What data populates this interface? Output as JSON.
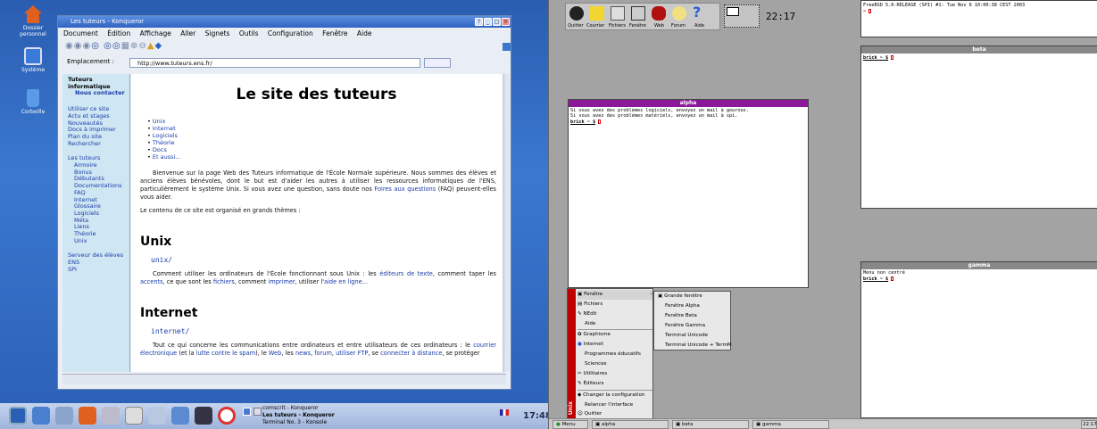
{
  "kde": {
    "desktop_icons": [
      {
        "label": "Dossier personnel",
        "color": "#e06020"
      },
      {
        "label": "Système",
        "color": "#3a7ad8"
      },
      {
        "label": "Corbeille",
        "color": "#5a9ae8"
      }
    ],
    "window_title": "Les tuteurs - Konqueror",
    "title_buttons": [
      "?",
      "_",
      "□",
      "×"
    ],
    "menu": [
      "Document",
      "Édition",
      "Affichage",
      "Aller",
      "Signets",
      "Outils",
      "Configuration",
      "Fenêtre",
      "Aide"
    ],
    "location_label": "Emplacement :",
    "url": "http://www.tuteurs.ens.fr/",
    "sidebar_top": [
      "Tuteurs informatique",
      "Nous contacter"
    ],
    "sidebar_links1": [
      "Utiliser ce site",
      "Actu et stages",
      "Nouveautés",
      "Docs à imprimer",
      "Plan du site",
      "Rechercher"
    ],
    "sidebar_head2": "Les tuteurs",
    "sidebar_links2": [
      "Armoire",
      "Bonus",
      "Débutants",
      "Documentations",
      "FAQ",
      "Internet",
      "Glossaire",
      "Logiciels",
      "Méta",
      "Liens",
      "Théorie",
      "Unix"
    ],
    "sidebar_links3": [
      "Serveur des élèves",
      "ENS",
      "SPI"
    ],
    "page_title": "Le site des tuteurs",
    "bullets": [
      "Unix",
      "Internet",
      "Logiciels",
      "Théorie",
      "Docs",
      "Et aussi..."
    ],
    "intro_p": "Bienvenue sur la page Web des Tuteurs informatique de l'École Normale supérieure. Nous sommes des élèves et anciens élèves bénévoles, dont le but est d'aider les autres à utiliser les ressources informatiques de l'ENS, particulièrement le système Unix. Si vous avez une question, sans doute nos",
    "intro_link": "Foires aux questions",
    "intro_end": "(FAQ) peuvent-elles vous aider.",
    "themes_p": "Le contenu de ce site est organisé en grands thèmes :",
    "unix_h": "Unix",
    "unix_code": "unix/",
    "unix_p1": "Comment utiliser les ordinateurs de l'École fonctionnant sous Unix : les",
    "unix_l1": "éditeurs de texte",
    "unix_p2": ", comment taper les",
    "unix_l2": "accents",
    "unix_p3": ", ce que sont les",
    "unix_l3": "fichiers",
    "unix_p4": ", comment",
    "unix_l4": "imprimer",
    "unix_p5": ", utiliser l'",
    "unix_l5": "aide en ligne...",
    "inet_h": "Internet",
    "inet_code": "internet/",
    "inet_p1": "Tout ce qui concerne les communications entre ordinateurs et entre utilisateurs de ces ordinateurs : le",
    "inet_l1": "courrier électronique",
    "inet_p2": "(et la",
    "inet_l2": "lutte contre le spam",
    "inet_p3": "), le",
    "inet_l3": "Web",
    "inet_p4": ", les",
    "inet_l4": "news",
    "inet_l5": "forum",
    "inet_l6": "utiliser FTP",
    "inet_p5": ", se",
    "inet_l7": "connecter à distance",
    "inet_p6": ", se protéger",
    "tasks": [
      "comscrit - Konqueror",
      "Les tuteurs - Konqueror",
      "Terminal No. 3 - Konsole"
    ],
    "clock": "17:48"
  },
  "x": {
    "dock_labels": [
      "Quitter",
      "Courrier",
      "Fichiers",
      "Fenêtre",
      "Web",
      "Forum",
      "Aide"
    ],
    "clock": "22:17",
    "term_top_line": "FreeBSD 5.0-RELEASE (SPI) #1: Tue Nov  6 10:00:38 CEST 2003",
    "alpha": {
      "title": "alpha",
      "lines": [
        "Si vous avez des problèmes logiciels, envoyez un mail à gourous.",
        "Si vous avez des problèmes matériels, envoyez un mail à spi."
      ],
      "prompt": "brick ~ $"
    },
    "beta": {
      "title": "beta",
      "prompt": "brick ~ $"
    },
    "gamma": {
      "title": "gamma",
      "line": "Menu non centré",
      "prompt": "brick ~ $"
    },
    "menu_side": "Unix",
    "menu_items": [
      "Fenêtre",
      "Fichiers",
      "NEdit",
      "Aide",
      "Graphisme",
      "Internet",
      "Programmes éducatifs",
      "Sciences",
      "Utilitaires",
      "Éditeurs",
      "Changer la configuration",
      "Relancer l'interface",
      "Quitter"
    ],
    "submenu": [
      "Grande fenêtre",
      "Fenêtre Alpha",
      "Fenêtre Beta",
      "Fenêtre Gamma",
      "Terminal Unicode",
      "Terminal Unicode + TermM"
    ],
    "taskbar": [
      "Menu",
      "alpha",
      "beta",
      "gamma"
    ],
    "taskbar_clock": "22:17",
    "colors": {
      "alpha_title": "#8a1a9a",
      "menu_side": "#c00000"
    }
  }
}
